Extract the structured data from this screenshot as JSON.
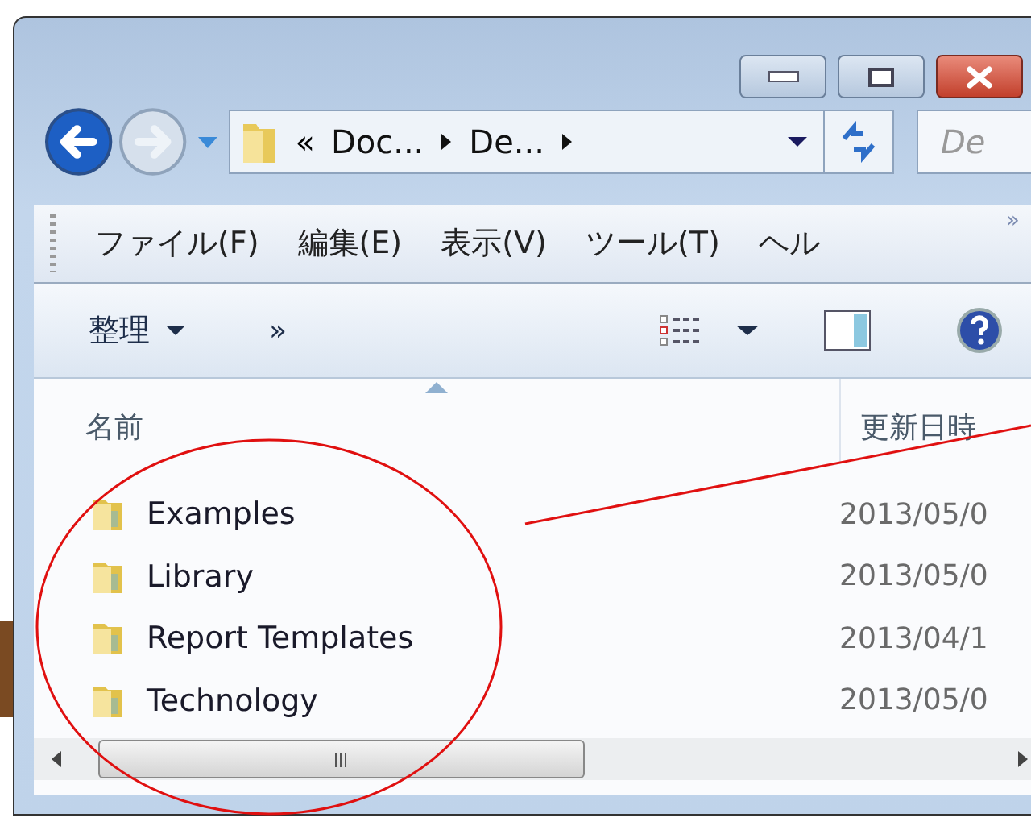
{
  "window": {
    "caption_buttons": [
      {
        "kind": "minimize"
      },
      {
        "kind": "maximize"
      },
      {
        "kind": "close"
      }
    ]
  },
  "address_bar": {
    "overflow": "«",
    "crumbs": [
      "Doc...",
      "De..."
    ]
  },
  "search": {
    "placeholder": "De"
  },
  "menu": {
    "items": [
      "ファイル(F)",
      "編集(E)",
      "表示(V)",
      "ツール(T)",
      "ヘル"
    ],
    "overflow": "»"
  },
  "toolbar": {
    "organize": "整理",
    "overflow": "»"
  },
  "columns": [
    {
      "label": "名前",
      "sorted": true
    },
    {
      "label": "更新日時",
      "sorted": false
    }
  ],
  "rows": [
    {
      "name": "Examples",
      "date": "2013/05/0"
    },
    {
      "name": "Library",
      "date": "2013/05/0"
    },
    {
      "name": "Report Templates",
      "date": "2013/04/1"
    },
    {
      "name": "Technology",
      "date": "2013/05/0"
    }
  ]
}
